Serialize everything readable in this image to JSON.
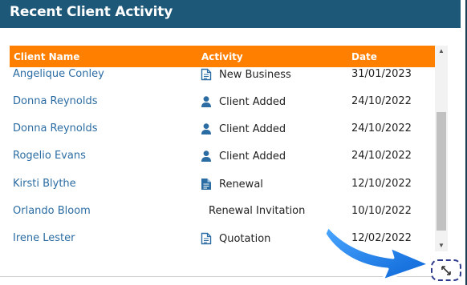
{
  "header": {
    "title": "Recent Client Activity"
  },
  "table": {
    "columns": [
      "Client Name",
      "Activity",
      "Date"
    ],
    "rows": [
      {
        "name": "Angelique Conley",
        "activity": "New Business",
        "icon": "document-icon",
        "date": "31/01/2023"
      },
      {
        "name": "Donna Reynolds",
        "activity": "Client Added",
        "icon": "user-icon",
        "date": "24/10/2022"
      },
      {
        "name": "Donna Reynolds",
        "activity": "Client Added",
        "icon": "user-icon",
        "date": "24/10/2022"
      },
      {
        "name": "Rogelio Evans",
        "activity": "Client Added",
        "icon": "user-icon",
        "date": "24/10/2022"
      },
      {
        "name": "Kirsti Blythe",
        "activity": "Renewal",
        "icon": "document-filled-icon",
        "date": "12/10/2022"
      },
      {
        "name": "Orlando Bloom",
        "activity": "Renewal Invitation",
        "icon": "",
        "date": "10/10/2022"
      },
      {
        "name": "Irene Lester",
        "activity": "Quotation",
        "icon": "document-icon",
        "date": "12/02/2022"
      }
    ]
  },
  "colors": {
    "header_bg": "#1d5878",
    "table_header_bg": "#ff7f00",
    "link": "#2b6ca3",
    "icon_blue": "#2b6ca3",
    "pointer_blue": "#1a7ee8"
  }
}
